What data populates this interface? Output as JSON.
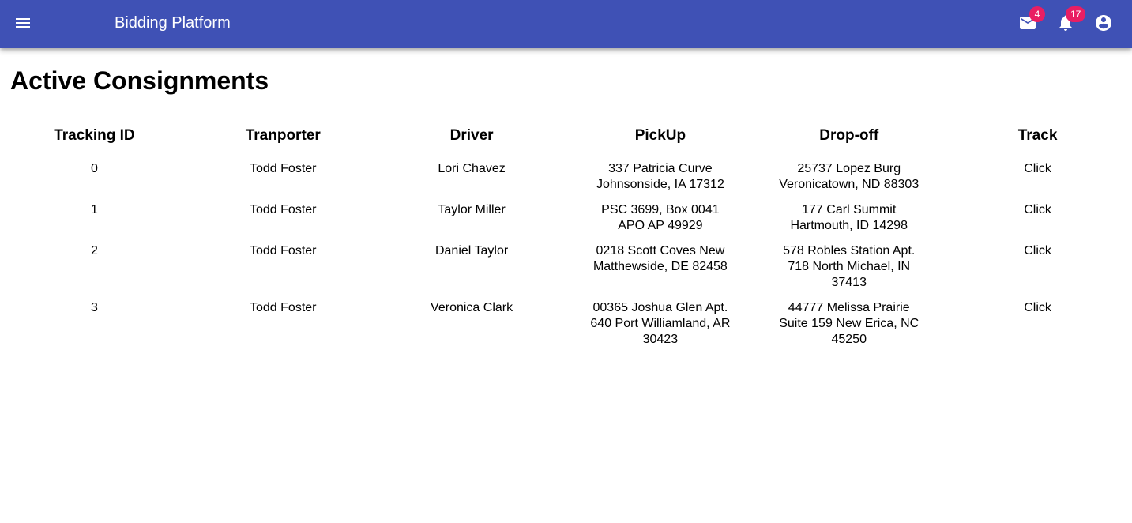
{
  "header": {
    "title": "Bidding Platform",
    "mail_badge": "4",
    "notifications_badge": "17"
  },
  "main": {
    "title": "Active Consignments",
    "columns": [
      "Tracking ID",
      "Tranporter",
      "Driver",
      "PickUp",
      "Drop-off",
      "Track"
    ],
    "rows": [
      {
        "tracking_id": "0",
        "transporter": "Todd Foster",
        "driver": "Lori Chavez",
        "pickup": "337 Patricia Curve Johnsonside, IA 17312",
        "dropoff": "25737 Lopez Burg Veronicatown, ND 88303",
        "track": "Click"
      },
      {
        "tracking_id": "1",
        "transporter": "Todd Foster",
        "driver": "Taylor Miller",
        "pickup": "PSC 3699, Box 0041 APO AP 49929",
        "dropoff": "177 Carl Summit Hartmouth, ID 14298",
        "track": "Click"
      },
      {
        "tracking_id": "2",
        "transporter": "Todd Foster",
        "driver": "Daniel Taylor",
        "pickup": "0218 Scott Coves New Matthewside, DE 82458",
        "dropoff": "578 Robles Station Apt. 718 North Michael, IN 37413",
        "track": "Click"
      },
      {
        "tracking_id": "3",
        "transporter": "Todd Foster",
        "driver": "Veronica Clark",
        "pickup": "00365 Joshua Glen Apt. 640 Port Williamland, AR 30423",
        "dropoff": "44777 Melissa Prairie Suite 159 New Erica, NC 45250",
        "track": "Click"
      }
    ]
  },
  "icons": {
    "menu": "menu-icon",
    "mail": "mail-icon",
    "notifications": "bell-icon",
    "account": "account-circle-icon"
  },
  "colors": {
    "appbar": "#3f51b5",
    "badge": "#e91e63"
  }
}
